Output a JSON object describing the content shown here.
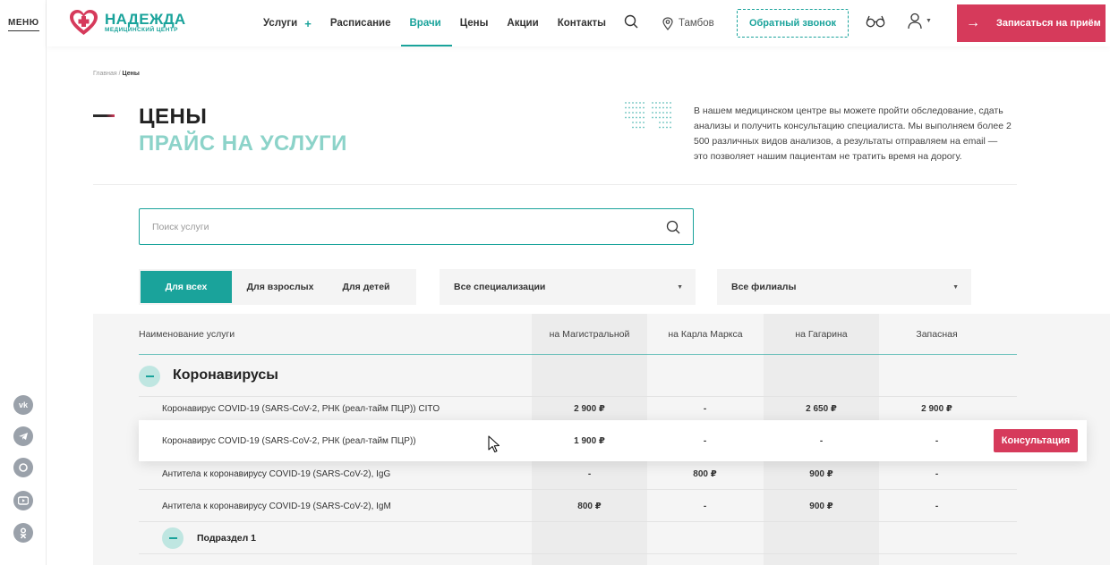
{
  "rail": {
    "menu_label": "МЕНЮ",
    "socials": [
      "vk-icon",
      "telegram-icon",
      "whatsapp-icon",
      "youtube-icon",
      "odnoklassniki-icon"
    ]
  },
  "header": {
    "logo_name": "НАДЕЖДА",
    "logo_sub": "МЕДИЦИНСКИЙ ЦЕНТР",
    "nav": [
      {
        "label": "Услуги",
        "has_plus": true
      },
      {
        "label": "Расписание"
      },
      {
        "label": "Врачи",
        "active": true
      },
      {
        "label": "Цены"
      },
      {
        "label": "Акции"
      },
      {
        "label": "Контакты"
      }
    ],
    "nav_plus": "+",
    "city": "Тамбов",
    "callback_label": "Обратный звонок",
    "appointment_label": "Записаться на приём",
    "appointment_arrow": "→"
  },
  "breadcrumb": {
    "home": "Главная",
    "sep": " / ",
    "current": "Цены"
  },
  "page": {
    "title": "ЦЕНЫ",
    "subtitle": "ПРАЙС НА УСЛУГИ",
    "intro": "В нашем медицинском центре вы можете пройти обследование, сдать анализы и получить консультацию специалиста. Мы выполняем более 2 500 различных видов анализов, а результаты отправляем на email — это позволяет нашим пациентам не тратить время на дорогу."
  },
  "search": {
    "placeholder": "Поиск услуги",
    "value": ""
  },
  "filters": {
    "audience": [
      "Для всех",
      "Для взрослых",
      "Для детей"
    ],
    "audience_selected": "Для всех",
    "specialization": "Все специализации",
    "branch": "Все филиалы"
  },
  "table": {
    "name_header": "Наименование услуги",
    "branches": [
      "на Магистральной",
      "на Карла Маркса",
      "на Гагарина",
      "Запасная"
    ],
    "group": "Коронавирусы",
    "rows": [
      {
        "name": "Коронавирус COVID-19 (SARS-CoV-2, РНК (реал-тайм ПЦР)) CITO",
        "prices": [
          "2 900 ₽",
          "-",
          "2 650 ₽",
          "2 900 ₽"
        ]
      },
      {
        "name": "Коронавирус COVID-19 (SARS-CoV-2, РНК (реал-тайм ПЦР))",
        "prices": [
          "1 900 ₽",
          "-",
          "-",
          "-"
        ]
      },
      {
        "name": "Антитела к коронавирусу COVID-19 (SARS-CoV-2), IgG",
        "prices": [
          "-",
          "800 ₽",
          "900 ₽",
          "-"
        ]
      },
      {
        "name": "Антитела к коронавирусу COVID-19 (SARS-CoV-2), IgM",
        "prices": [
          "800 ₽",
          "-",
          "900 ₽",
          "-"
        ]
      }
    ],
    "subgroup": "Подраздел 1",
    "consult_label": "Консультация"
  },
  "colors": {
    "brand_teal": "#1aa39b",
    "accent_red": "#d63a5b",
    "light_teal": "#8cd3c9"
  }
}
